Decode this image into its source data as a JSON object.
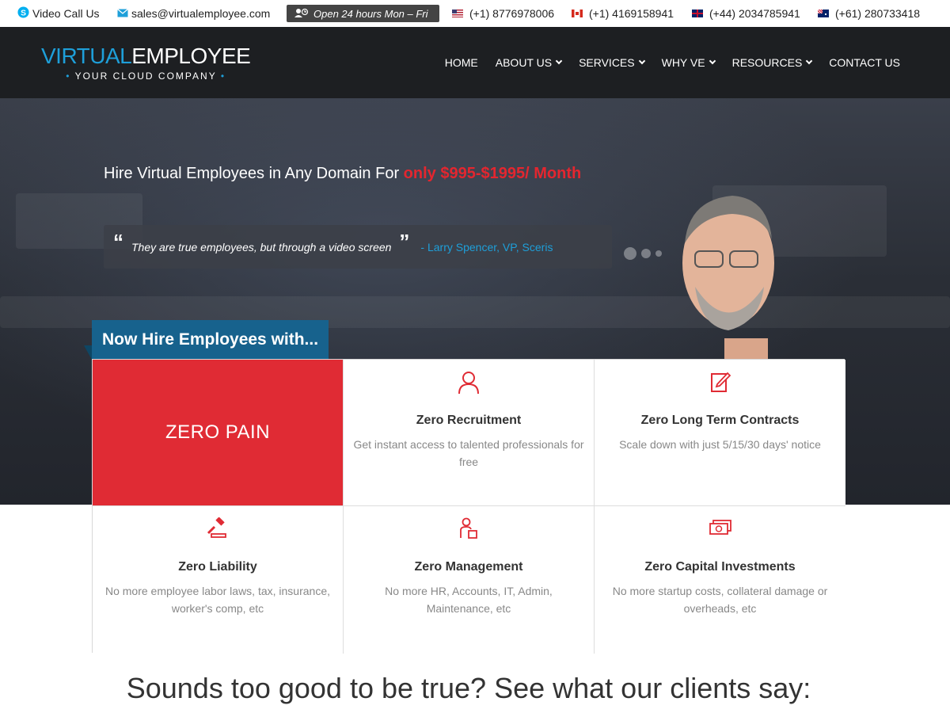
{
  "topbar": {
    "video_call": "Video Call Us",
    "email": "sales@virtualemployee.com",
    "hours": "Open 24 hours Mon – Fri",
    "phones": [
      {
        "country": "us",
        "number": "(+1) 8776978006"
      },
      {
        "country": "ca",
        "number": "(+1) 4169158941"
      },
      {
        "country": "uk",
        "number": "(+44) 2034785941"
      },
      {
        "country": "au",
        "number": "(+61) 280733418"
      }
    ]
  },
  "logo": {
    "part1": "VIRTUAL",
    "part2": "EMPLOYEE",
    "tagline": "YOUR CLOUD COMPANY"
  },
  "nav": {
    "items": [
      {
        "label": "HOME"
      },
      {
        "label": "ABOUT US"
      },
      {
        "label": "SERVICES"
      },
      {
        "label": "WHY VE"
      },
      {
        "label": "RESOURCES"
      },
      {
        "label": "CONTACT US"
      }
    ]
  },
  "hero": {
    "headline": "Hire Virtual Employees in Any Domain For ",
    "price": "only $995-$1995/ Month",
    "quote": "They are true employees, but through a video screen",
    "quote_author": "- Larry Spencer, VP, Sceris",
    "tag": "Now Hire Employees with..."
  },
  "features": {
    "zero_pain": "ZERO PAIN",
    "items": [
      {
        "icon": "user-icon",
        "title": "Zero Recruitment",
        "desc": "Get instant access to talented professionals for free"
      },
      {
        "icon": "edit-document-icon",
        "title": "Zero Long Term Contracts",
        "desc": "Scale down with just 5/15/30 days' notice"
      },
      {
        "icon": "gavel-icon",
        "title": "Zero Liability",
        "desc": "No more employee labor laws, tax, insurance, worker's comp, etc"
      },
      {
        "icon": "manager-icon",
        "title": "Zero Management",
        "desc": "No more HR, Accounts, IT, Admin, Maintenance, etc"
      },
      {
        "icon": "money-icon",
        "title": "Zero Capital Investments",
        "desc": "No more startup costs, collateral damage or overheads, etc"
      }
    ]
  },
  "testimonials": {
    "title": "Sounds too good to be true? See what our clients say:"
  },
  "colors": {
    "accent_blue": "#1e9fd9",
    "accent_red": "#e02b34",
    "nav_bg": "#1d1f22",
    "tag_bg": "#17628d"
  }
}
